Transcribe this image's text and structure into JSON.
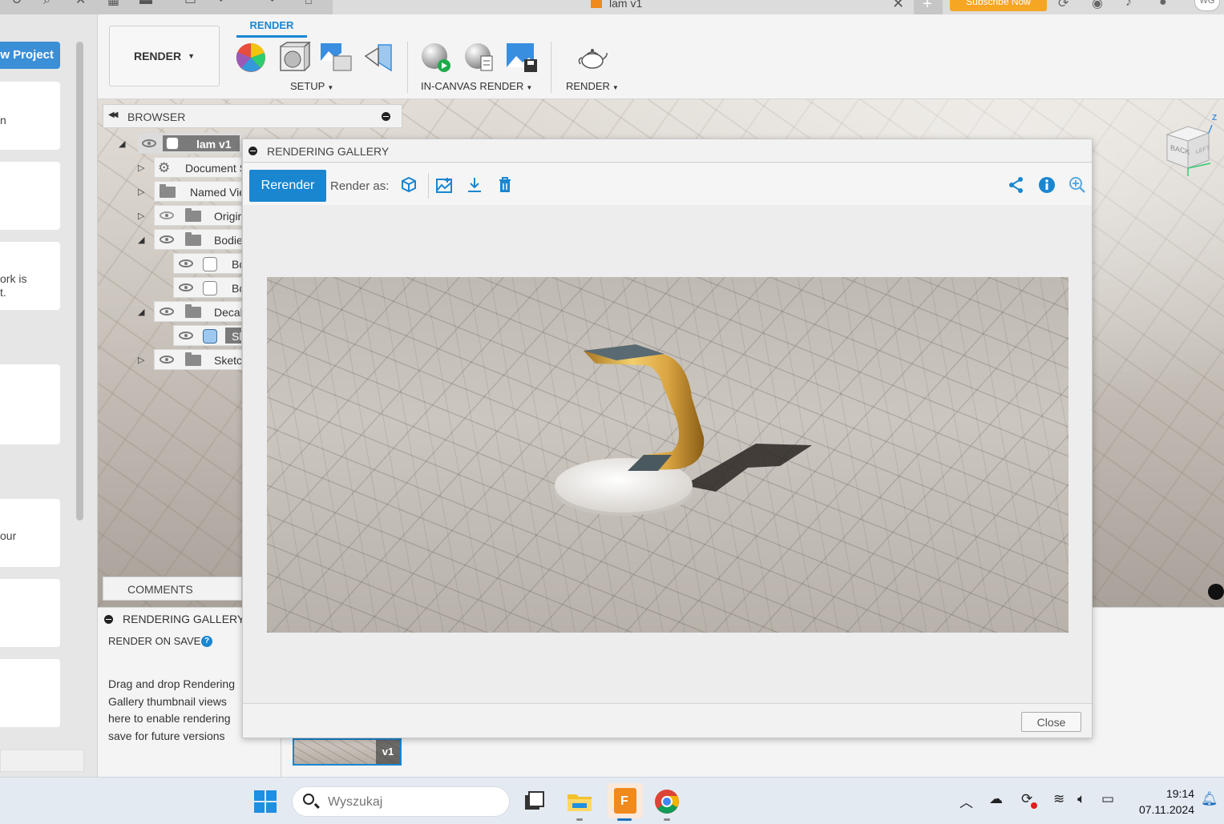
{
  "window": {
    "title": "lam v1",
    "subscribe_label": "Subscribe Now",
    "user_initials": "WG"
  },
  "left_panel": {
    "new_project_label": "w Project",
    "card_fragments": [
      "n",
      "ork is",
      "t.",
      "our"
    ]
  },
  "toolbar": {
    "workspace_label": "RENDER",
    "active_tab": "RENDER",
    "groups": {
      "setup": "SETUP",
      "in_canvas": "IN-CANVAS RENDER",
      "render": "RENDER"
    }
  },
  "browser": {
    "title": "BROWSER",
    "root_label": "lam v1",
    "items": [
      {
        "label": "Document S"
      },
      {
        "label": "Named Vie"
      },
      {
        "label": "Origir"
      },
      {
        "label": "Bodie"
      },
      {
        "label": "Bc"
      },
      {
        "label": "Bc"
      },
      {
        "label": "Decal"
      },
      {
        "label": "Sl"
      },
      {
        "label": "Sketc"
      }
    ]
  },
  "comments": {
    "title": "COMMENTS"
  },
  "gallery_panel": {
    "title": "RENDERING GALLERY",
    "render_on_save": "RENDER ON SAVE",
    "help": "?",
    "hint": "Drag and drop Rendering Gallery thumbnail views here to enable rendering save for future versions",
    "thumbnail_version": "v1"
  },
  "dialog": {
    "title": "RENDERING GALLERY",
    "rerender_label": "Rerender",
    "render_as_label": "Render as:",
    "close_label": "Close"
  },
  "viewcube": {
    "back": "BACK",
    "left": "LEFT",
    "axis_z": "Z"
  },
  "taskbar": {
    "search_placeholder": "Wyszukaj",
    "time": "19:14",
    "date": "07.11.2024"
  },
  "colors": {
    "accent": "#1a86d0",
    "subscribe": "#f5a623",
    "fusion_orange": "#f08a1c"
  }
}
